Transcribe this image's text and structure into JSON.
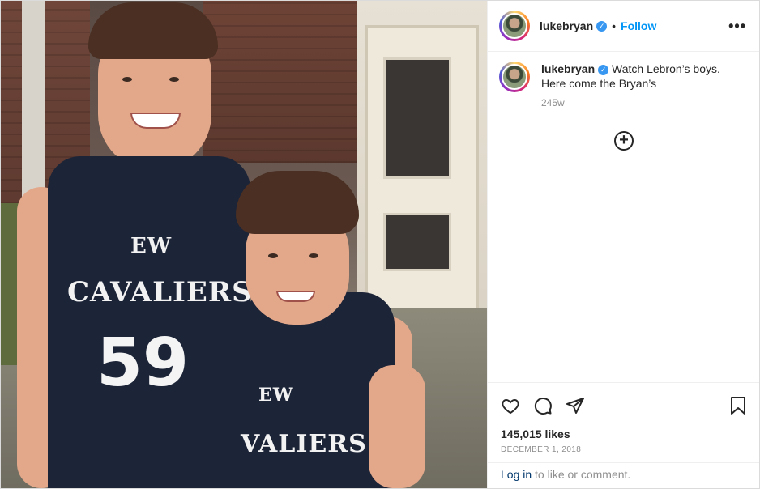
{
  "header": {
    "username": "lukebryan",
    "follow_label": "Follow",
    "more_label": "•••"
  },
  "photo": {
    "jersey_text_big": "CAVALIERS",
    "jersey_number_big": "59",
    "jersey_text_small": "VALIERS",
    "jersey_logo": "EW"
  },
  "caption": {
    "username": "lukebryan",
    "text": "Watch Lebron’s boys. Here come the Bryan’s",
    "time_ago": "245w"
  },
  "actions": {
    "icons": [
      "heart-icon",
      "comment-icon",
      "share-icon",
      "bookmark-icon"
    ]
  },
  "stats": {
    "likes": "145,015 likes",
    "date": "DECEMBER 1, 2018"
  },
  "login": {
    "link": "Log in",
    "rest": " to like or comment."
  },
  "colors": {
    "accent": "#0095f6",
    "verified": "#3897f0",
    "jersey": "#1c2438"
  }
}
